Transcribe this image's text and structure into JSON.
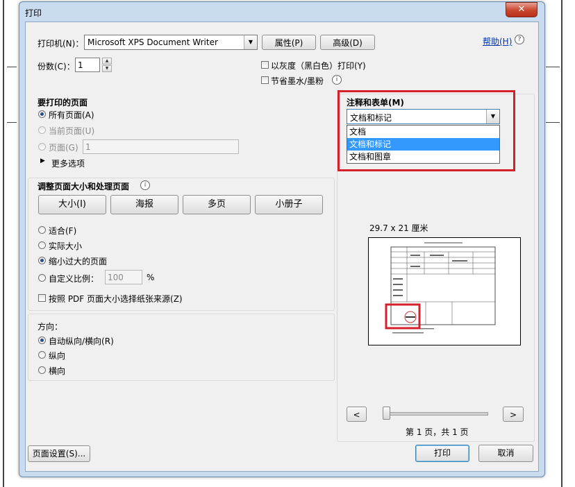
{
  "dialog": {
    "title": "打印",
    "close_glyph": "✕",
    "help": "帮助(H)",
    "help_icon": "?"
  },
  "printer": {
    "label": "打印机(N)：",
    "value": "Microsoft XPS Document Writer",
    "properties": "属性(P)",
    "advanced": "高级(D)"
  },
  "copies": {
    "label": "份数(C)：",
    "value": "1"
  },
  "options": {
    "grayscale": "以灰度（黑白色）打印(Y)",
    "save_ink": "节省墨水/墨粉"
  },
  "pages": {
    "heading": "要打印的页面",
    "all": "所有页面(A)",
    "current": "当前页面(U)",
    "range": "页面(G)",
    "range_value": "1",
    "more": "更多选项"
  },
  "sizing": {
    "heading": "调整页面大小和处理页面",
    "buttons": [
      "大小(I)",
      "海报",
      "多页",
      "小册子"
    ],
    "fit": "适合(F)",
    "actual": "实际大小",
    "shrink": "缩小过大的页面",
    "custom": "自定义比例：",
    "custom_value": "100",
    "percent": "%",
    "paper_source": "按照 PDF 页面大小选择纸张来源(Z)"
  },
  "orientation": {
    "heading": "方向：",
    "auto": "自动纵向/横向(R)",
    "portrait": "纵向",
    "landscape": "横向"
  },
  "annotations": {
    "heading": "注释和表单(M)",
    "selected": "文档和标记",
    "options": [
      "文档",
      "文档和标记",
      "文档和图章"
    ]
  },
  "preview": {
    "size": "29.7 x 21 厘米",
    "page_info": "第 1 页，共 1 页",
    "prev": "<",
    "next": ">"
  },
  "footer": {
    "page_setup": "页面设置(S)...",
    "print": "打印",
    "cancel": "取消"
  }
}
